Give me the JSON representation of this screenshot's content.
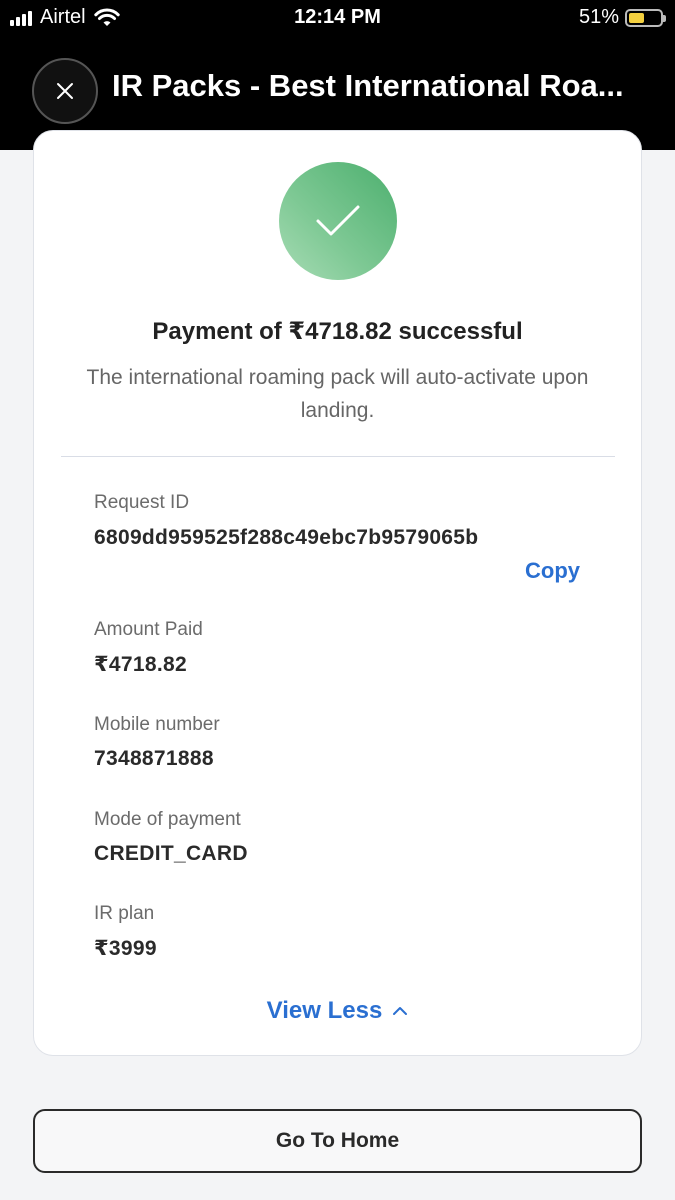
{
  "status_bar": {
    "carrier": "Airtel",
    "time": "12:14 PM",
    "battery_percent": "51%",
    "battery_level": 0.51
  },
  "header": {
    "title": "IR Packs - Best International Roa..."
  },
  "payment": {
    "title": "Payment of ₹4718.82 successful",
    "subtitle": "The international roaming pack will auto-activate upon landing."
  },
  "details": {
    "request_id_label": "Request ID",
    "request_id_value": "6809dd959525f288c49ebc7b9579065b",
    "copy_label": "Copy",
    "amount_label": "Amount Paid",
    "amount_value": "₹4718.82",
    "mobile_label": "Mobile number",
    "mobile_value": "7348871888",
    "mode_label": "Mode of payment",
    "mode_value": "CREDIT_CARD",
    "plan_label": "IR plan",
    "plan_value": "₹3999"
  },
  "view_less_label": "View Less",
  "home_button_label": "Go To Home",
  "colors": {
    "accent": "#2a6fd1",
    "success": "#5cb87a"
  }
}
